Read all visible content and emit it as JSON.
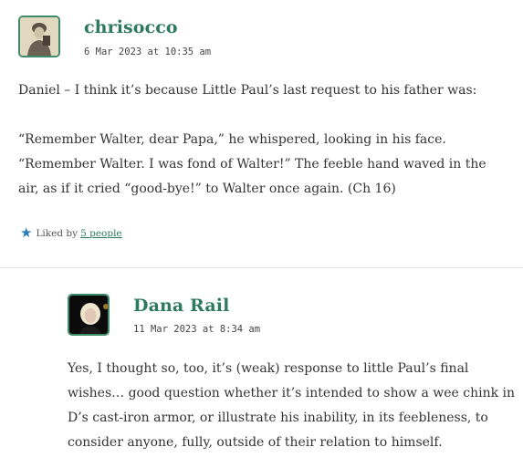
{
  "comments": [
    {
      "author": "chrisocco",
      "date": "6 Mar 2023 at 10:35 am",
      "paragraphs": [
        "Daniel – I think it’s because Little Paul’s last request to his father was:",
        "“Remember Walter, dear Papa,” he whispered, looking in his face. “Remember Walter. I was fond of Walter!” The feeble hand waved in the air, as if it cried “good-bye!” to Walter once again. (Ch 16)"
      ],
      "likes_prefix": "Liked by",
      "likes_link": "5 people",
      "avatar_icon": "vintage-portrait-avatar"
    },
    {
      "author": "Dana Rail",
      "date": "11 Mar 2023 at 8:34 am",
      "paragraphs": [
        "Yes, I thought so, too, it’s (weak) response to little Paul’s final wishes… good question whether it’s intended to show a wee chink in D’s cast-iron armor, or illustrate his inability, in its feebleness, to consider anyone, fully, outside of their relation to himself."
      ],
      "avatar_icon": "blonde-portrait-avatar"
    }
  ],
  "colors": {
    "author": "#2d7a5f",
    "star": "#2a7fb8",
    "divider": "#e6e6e6"
  }
}
